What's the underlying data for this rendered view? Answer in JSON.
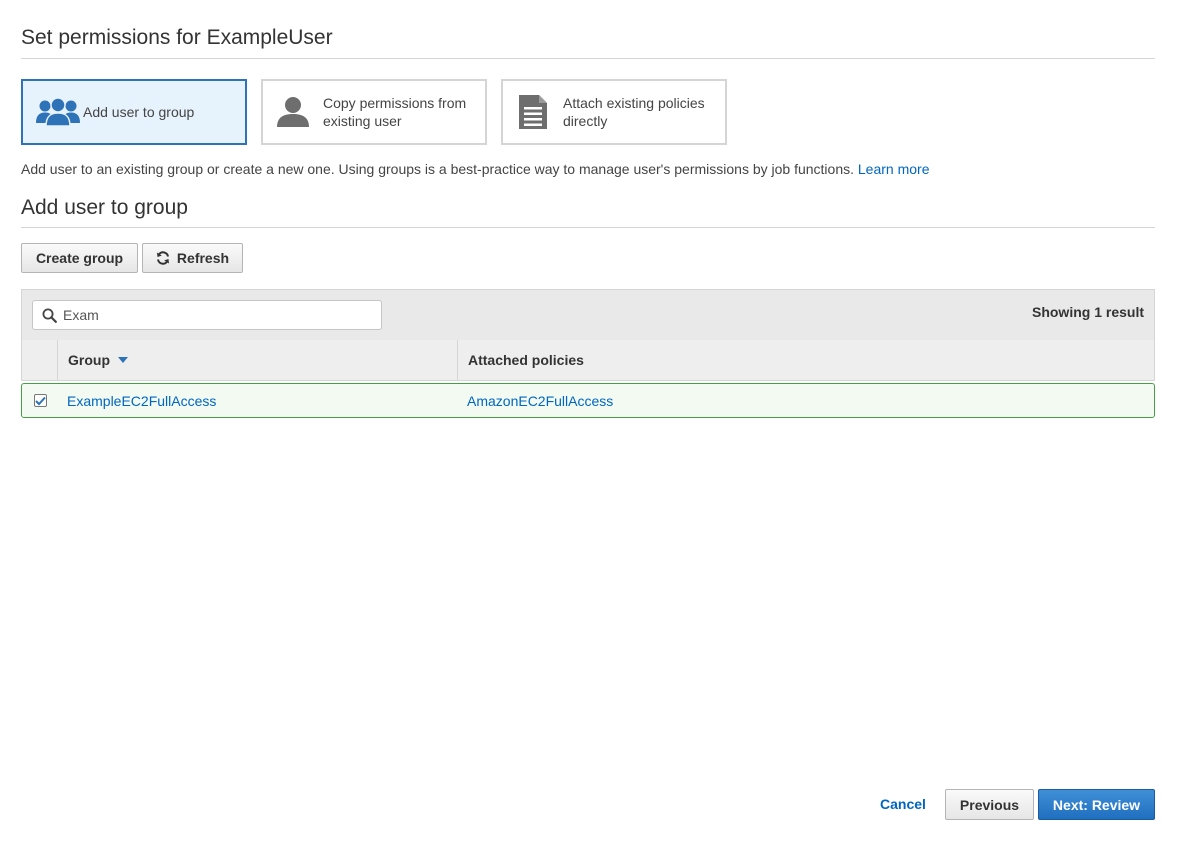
{
  "page": {
    "title": "Set permissions for ExampleUser"
  },
  "options": [
    {
      "label": "Add user to group",
      "icon": "users-group-icon",
      "selected": true
    },
    {
      "label": "Copy permissions from existing user",
      "icon": "user-icon",
      "selected": false
    },
    {
      "label": "Attach existing policies directly",
      "icon": "document-icon",
      "selected": false
    }
  ],
  "description": {
    "text": "Add user to an existing group or create a new one. Using groups is a best-practice way to manage user's permissions by job functions.",
    "link": "Learn more"
  },
  "section": {
    "title": "Add user to group"
  },
  "toolbar": {
    "create_group_label": "Create group",
    "refresh_label": "Refresh"
  },
  "table": {
    "search_value": "Exam",
    "result_count": "Showing 1 result",
    "columns": {
      "group": "Group",
      "policies": "Attached policies"
    },
    "rows": [
      {
        "group": "ExampleEC2FullAccess",
        "policies": "AmazonEC2FullAccess",
        "checked": true
      }
    ]
  },
  "footer": {
    "cancel_label": "Cancel",
    "previous_label": "Previous",
    "next_label": "Next: Review"
  },
  "colors": {
    "accent": "#0066c0",
    "selected_border": "#2e73b8",
    "selected_bg": "#e6f2fc",
    "row_border": "#45a045",
    "primary_button": "#1f6fbf"
  }
}
